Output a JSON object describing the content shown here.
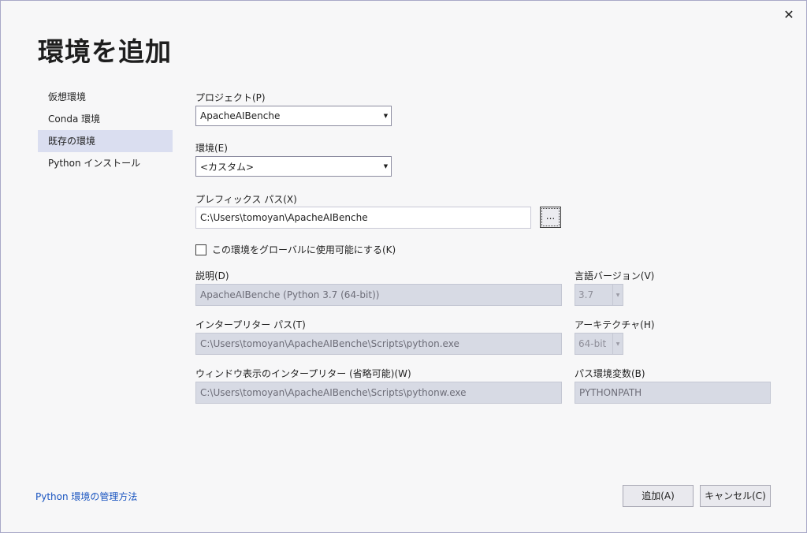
{
  "dialog": {
    "title": "環境を追加",
    "close_glyph": "✕"
  },
  "nav": {
    "items": [
      {
        "label": "仮想環境",
        "selected": false
      },
      {
        "label": "Conda 環境",
        "selected": false
      },
      {
        "label": "既存の環境",
        "selected": true
      },
      {
        "label": "Python インストール",
        "selected": false
      }
    ]
  },
  "form": {
    "project": {
      "label": "プロジェクト(P)",
      "value": "ApacheAIBenche"
    },
    "environment": {
      "label": "環境(E)",
      "value": "<カスタム>"
    },
    "prefix_path": {
      "label": "プレフィックス パス(X)",
      "value": "C:\\Users\\tomoyan\\ApacheAIBenche",
      "browse_label": "..."
    },
    "global_checkbox": {
      "label": "この環境をグローバルに使用可能にする(K)",
      "checked": false
    },
    "description": {
      "label": "説明(D)",
      "value": "ApacheAIBenche (Python 3.7 (64-bit))"
    },
    "language_version": {
      "label": "言語バージョン(V)",
      "value": "3.7"
    },
    "interpreter_path": {
      "label": "インタープリター パス(T)",
      "value": "C:\\Users\\tomoyan\\ApacheAIBenche\\Scripts\\python.exe"
    },
    "architecture": {
      "label": "アーキテクチャ(H)",
      "value": "64-bit"
    },
    "windowed_interpreter": {
      "label": "ウィンドウ表示のインタープリター (省略可能)(W)",
      "value": "C:\\Users\\tomoyan\\ApacheAIBenche\\Scripts\\pythonw.exe"
    },
    "path_env_var": {
      "label": "パス環境変数(B)",
      "value": "PYTHONPATH"
    }
  },
  "footer": {
    "help_link": "Python 環境の管理方法",
    "add_button": "追加(A)",
    "cancel_button": "キャンセル(C)"
  },
  "colors": {
    "accent": "#1a55c0",
    "selected_nav_bg": "#dadef0",
    "disabled_field_bg": "#d7dae4"
  }
}
